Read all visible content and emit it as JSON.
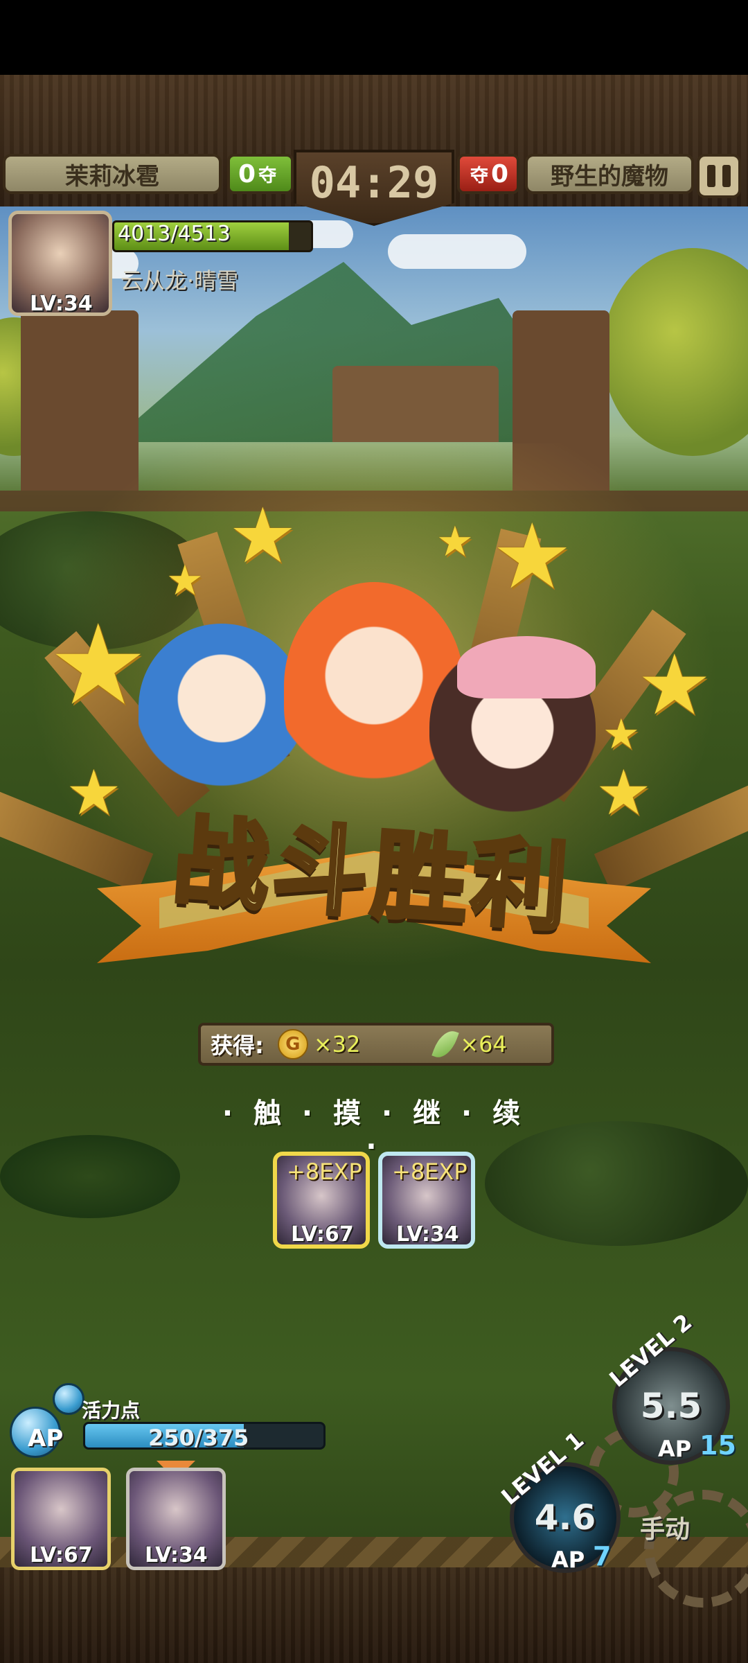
{
  "hud": {
    "player_team_name": "茉莉冰雹",
    "player_score": "0",
    "timer": "04:29",
    "enemy_score": "0",
    "enemy_team_name": "野生的魔物",
    "score_icon_text": "夺"
  },
  "active_character": {
    "level": "LV:34",
    "hp": "4013/4513",
    "hp_fraction": 0.889,
    "name": "云从龙·晴雪"
  },
  "victory": {
    "title": "战斗胜利",
    "rewards_label": "获得:",
    "coin_symbol": "G",
    "coin_amount": "×32",
    "exp_amount": "×64",
    "continue_text": "· 触 · 摸 · 继 · 续 ·"
  },
  "exp_cards": [
    {
      "exp": "+8EXP",
      "level": "LV:67"
    },
    {
      "exp": "+8EXP",
      "level": "LV:34"
    }
  ],
  "ap": {
    "label": "活力点",
    "badge": "AP",
    "value": "250/375",
    "fraction": 0.667
  },
  "team": [
    {
      "level": "LV:67"
    },
    {
      "level": "LV:34"
    }
  ],
  "skills": {
    "level1": {
      "label": "LEVEL 1",
      "value": "4.6",
      "ap_label": "AP",
      "ap_cost": "7"
    },
    "level2": {
      "label": "LEVEL 2",
      "value": "5.5",
      "ap_label": "AP",
      "ap_cost": "15"
    },
    "manual_label": "手动"
  },
  "colors": {
    "accent_gold": "#f6ec9b",
    "hp_green": "#9fcf3f",
    "ap_blue": "#67c7f0"
  }
}
